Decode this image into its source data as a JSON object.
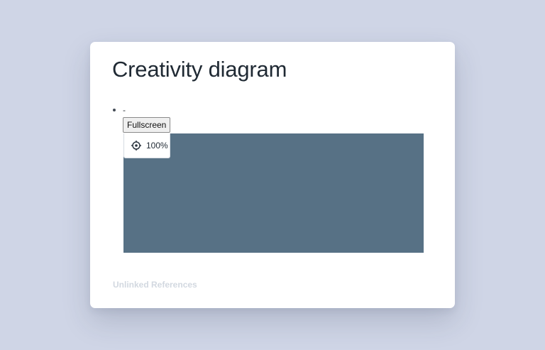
{
  "page": {
    "title": "Creativity diagram"
  },
  "block": {
    "bullet_text": "-"
  },
  "diagram": {
    "fullscreen_label": "Fullscreen",
    "zoom_label": "100%",
    "zoom_icon": "target-icon",
    "canvas_color": "#577185"
  },
  "references": {
    "unlinked_label": "Unlinked References"
  },
  "colors": {
    "background": "#cfd5e6",
    "card": "#ffffff",
    "title": "#1f2933",
    "muted": "#d2d8e0"
  }
}
